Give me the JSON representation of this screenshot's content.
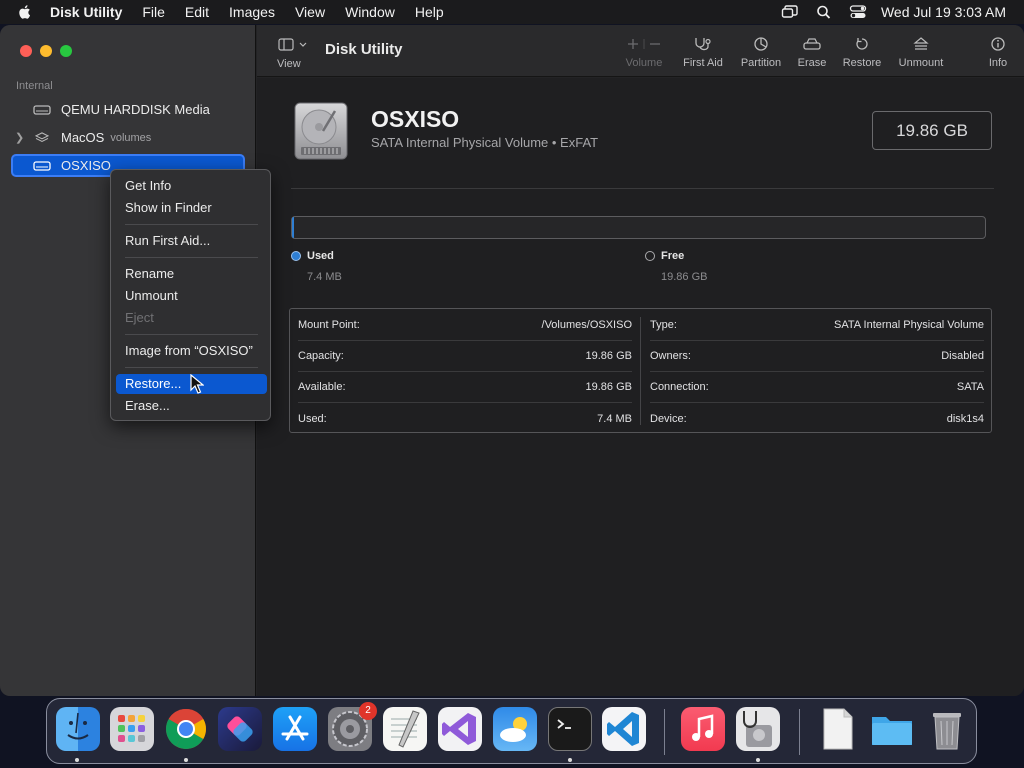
{
  "menubar": {
    "app": "Disk Utility",
    "items": [
      "File",
      "Edit",
      "Images",
      "View",
      "Window",
      "Help"
    ],
    "clock": "Wed Jul 19  3:03 AM"
  },
  "sidebar": {
    "section": "Internal",
    "items": [
      {
        "label": "QEMU HARDDISK Media"
      },
      {
        "label": "MacOS",
        "sub": "volumes"
      },
      {
        "label": "OSXISO"
      }
    ]
  },
  "toolbar": {
    "view_label": "View",
    "title": "Disk Utility",
    "buttons": [
      {
        "label": "Volume"
      },
      {
        "label": "First Aid"
      },
      {
        "label": "Partition"
      },
      {
        "label": "Erase"
      },
      {
        "label": "Restore"
      },
      {
        "label": "Unmount"
      },
      {
        "label": "Info"
      }
    ]
  },
  "volume": {
    "name": "OSXISO",
    "subtitle": "SATA Internal Physical Volume • ExFAT",
    "capacity": "19.86 GB",
    "used_label": "Used",
    "used_value": "7.4 MB",
    "free_label": "Free",
    "free_value": "19.86 GB",
    "used_fraction": 0.0004
  },
  "info": {
    "left": [
      {
        "k": "Mount Point:",
        "v": "/Volumes/OSXISO"
      },
      {
        "k": "Capacity:",
        "v": "19.86 GB"
      },
      {
        "k": "Available:",
        "v": "19.86 GB"
      },
      {
        "k": "Used:",
        "v": "7.4 MB"
      }
    ],
    "right": [
      {
        "k": "Type:",
        "v": "SATA Internal Physical Volume"
      },
      {
        "k": "Owners:",
        "v": "Disabled"
      },
      {
        "k": "Connection:",
        "v": "SATA"
      },
      {
        "k": "Device:",
        "v": "disk1s4"
      }
    ]
  },
  "context_menu": {
    "get_info": "Get Info",
    "show_in_finder": "Show in Finder",
    "run_first_aid": "Run First Aid...",
    "rename": "Rename",
    "unmount": "Unmount",
    "eject": "Eject",
    "image_from": "Image from “OSXISO”",
    "restore": "Restore...",
    "erase": "Erase..."
  },
  "dock": {
    "settings_badge": "2",
    "icons": [
      "finder-icon",
      "launchpad-icon",
      "chrome-icon",
      "shortcuts-icon",
      "app-store-icon",
      "system-settings-icon",
      "textedit-icon",
      "visual-studio-icon",
      "weather-icon",
      "terminal-icon",
      "vscode-icon",
      "music-icon",
      "disk-utility-icon",
      "rtf-document-icon",
      "folder-icon",
      "trash-icon"
    ]
  },
  "colors": {
    "accent": "#0b58d0",
    "window_bg": "#1f1f21",
    "sidebar_bg": "#353537"
  }
}
